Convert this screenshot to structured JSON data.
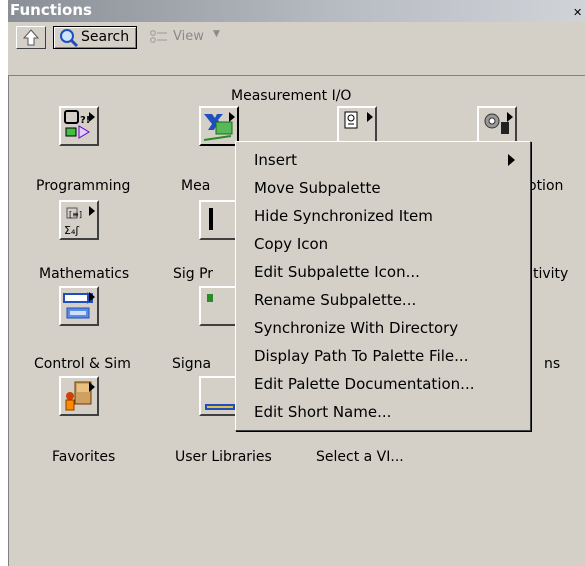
{
  "window": {
    "title": "Functions"
  },
  "toolbar": {
    "search_label": "Search",
    "view_label": "View"
  },
  "palette": {
    "section_header": "Measurement I/O",
    "items": [
      {
        "label": "Programming"
      },
      {
        "label": "Mea"
      },
      {
        "label": "otion"
      },
      {
        "label": "Mathematics"
      },
      {
        "label": "Sig Pr"
      },
      {
        "label": "tivity"
      },
      {
        "label": "Control & Sim"
      },
      {
        "label": "Signa"
      },
      {
        "label": "ns"
      },
      {
        "label": "Favorites"
      },
      {
        "label": "User Libraries"
      },
      {
        "label": "Select a VI..."
      }
    ]
  },
  "context_menu": {
    "items": [
      {
        "label": "Insert"
      },
      {
        "label": "Move Subpalette"
      },
      {
        "label": "Hide Synchronized Item"
      },
      {
        "label": "Copy Icon"
      },
      {
        "label": "Edit Subpalette Icon..."
      },
      {
        "label": "Rename Subpalette..."
      },
      {
        "label": "Synchronize With Directory"
      },
      {
        "label": "Display Path To Palette File..."
      },
      {
        "label": "Edit Palette Documentation..."
      },
      {
        "label": "Edit Short Name..."
      }
    ]
  },
  "colors": {
    "face": "#d4d0c8",
    "title_gradient_start": "#8a8f97",
    "accent_blue": "#1f4fbf"
  }
}
